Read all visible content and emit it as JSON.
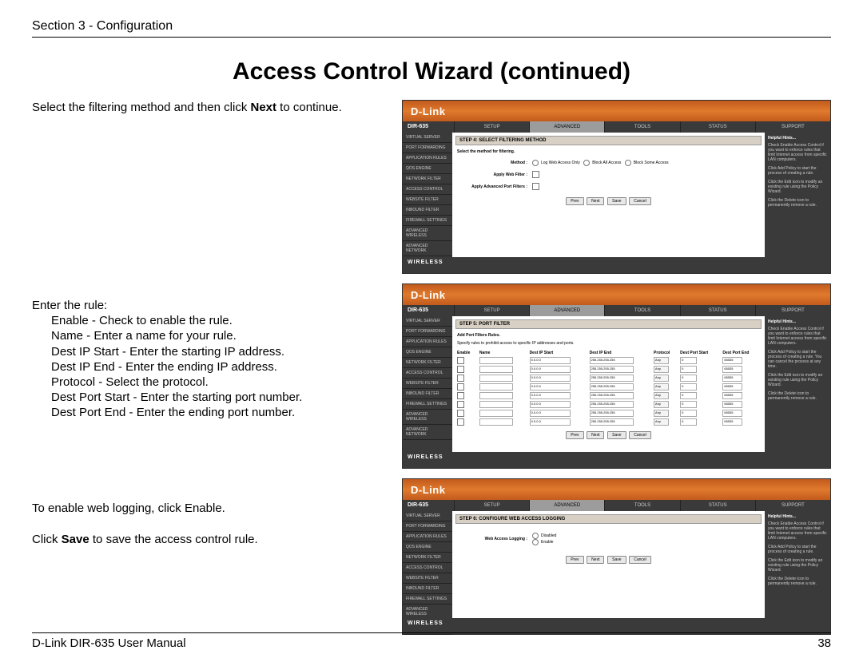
{
  "header": "Section 3 - Configuration",
  "title": "Access Control Wizard (continued)",
  "left": {
    "p1_a": "Select the filtering method and then click ",
    "p1_b": "Next",
    "p1_c": " to continue.",
    "rule_intro": "Enter the rule:",
    "rules": [
      "Enable - Check to enable the rule.",
      "Name - Enter a name for your rule.",
      "Dest IP Start - Enter the starting IP address.",
      "Dest IP End - Enter the ending IP address.",
      "Protocol - Select the protocol.",
      "Dest Port Start - Enter the starting port number.",
      "Dest Port End - Enter the ending port number."
    ],
    "p3": "To enable web logging, click Enable.",
    "p4_a": "Click ",
    "p4_b": "Save",
    "p4_c": " to save the access control rule."
  },
  "dlink": {
    "logo": "D-Link",
    "model": "DIR-635",
    "tabs": [
      "SETUP",
      "ADVANCED",
      "TOOLS",
      "STATUS",
      "SUPPORT"
    ],
    "sidebar": [
      "VIRTUAL SERVER",
      "PORT FORWARDING",
      "APPLICATION RULES",
      "QOS ENGINE",
      "NETWORK FILTER",
      "ACCESS CONTROL",
      "WEBSITE FILTER",
      "INBOUND FILTER",
      "FIREWALL SETTINGS",
      "ADVANCED WIRELESS",
      "ADVANCED NETWORK"
    ],
    "hints_title": "Helpful Hints...",
    "bottom": "WIRELESS",
    "btns": {
      "prev": "Prev",
      "next": "Next",
      "save": "Save",
      "cancel": "Cancel"
    }
  },
  "ss1": {
    "step": "STEP 4: SELECT FILTERING METHOD",
    "sub": "Select the method for filtering.",
    "method_label": "Method :",
    "methods": [
      "Log Web Access Only",
      "Block All Access",
      "Block Some Access"
    ],
    "webfilter_label": "Apply Web Filter :",
    "portfilter_label": "Apply Advanced Port Filters :"
  },
  "ss2": {
    "step": "STEP 5: PORT FILTER",
    "sub": "Add Port Filters Rules.",
    "desc": "Specify rules to prohibit access to specific IP addresses and ports.",
    "headers": [
      "Enable",
      "Name",
      "Dest IP Start",
      "Dest IP End",
      "Protocol",
      "Dest Port Start",
      "Dest Port End"
    ],
    "rows": [
      {
        "start": "0.0.0.0",
        "end": "255.255.255.255",
        "proto": "Any",
        "ps": "0",
        "pe": "65535"
      },
      {
        "start": "0.0.0.0",
        "end": "255.255.255.255",
        "proto": "Any",
        "ps": "0",
        "pe": "65535"
      },
      {
        "start": "0.0.0.0",
        "end": "255.255.255.255",
        "proto": "Any",
        "ps": "0",
        "pe": "65535"
      },
      {
        "start": "0.0.0.0",
        "end": "255.255.255.255",
        "proto": "Any",
        "ps": "0",
        "pe": "65535"
      },
      {
        "start": "0.0.0.0",
        "end": "255.255.255.255",
        "proto": "Any",
        "ps": "0",
        "pe": "65535"
      },
      {
        "start": "0.0.0.0",
        "end": "255.255.255.255",
        "proto": "Any",
        "ps": "0",
        "pe": "65535"
      },
      {
        "start": "0.0.0.0",
        "end": "255.255.255.255",
        "proto": "Any",
        "ps": "0",
        "pe": "65535"
      },
      {
        "start": "0.0.0.0",
        "end": "255.255.255.255",
        "proto": "Any",
        "ps": "0",
        "pe": "65535"
      }
    ]
  },
  "ss3": {
    "step": "STEP 6: CONFIGURE WEB ACCESS LOGGING",
    "label": "Web Access Logging :",
    "opts": [
      "Disabled",
      "Enable"
    ]
  },
  "footer": {
    "left": "D-Link DIR-635 User Manual",
    "right": "38"
  }
}
